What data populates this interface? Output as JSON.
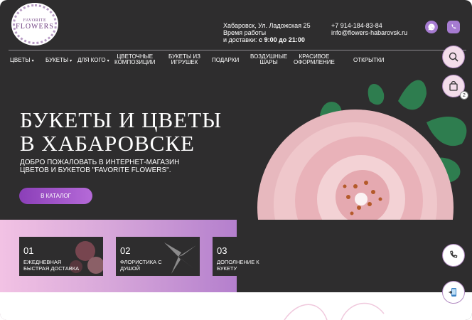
{
  "logo": {
    "line1": "FAVORITE",
    "line2": "FLOWERS"
  },
  "header": {
    "address": "Хабаровск, Ул. Ладожская 25",
    "hours_line1": "Время работы",
    "hours_line2": "и доставки:",
    "hours_value": "с 9:00 до 21:00",
    "phone": "+7 914-184-83-84",
    "email": "info@flowers-habarovsk.ru"
  },
  "nav": [
    {
      "l1": "Цветы",
      "l2": "",
      "caret": "▾"
    },
    {
      "l1": "Букеты",
      "l2": "",
      "caret": "▾"
    },
    {
      "l1": "Для кого",
      "l2": "",
      "caret": "▾"
    },
    {
      "l1": "Цветочные",
      "l2": "композиции",
      "caret": ""
    },
    {
      "l1": "Букеты из",
      "l2": "игрушек",
      "caret": ""
    },
    {
      "l1": "Подарки",
      "l2": "",
      "caret": ""
    },
    {
      "l1": "Воздушные",
      "l2": "шары",
      "caret": ""
    },
    {
      "l1": "Красивое",
      "l2": "оформление",
      "caret": ""
    },
    {
      "l1": "Открытки",
      "l2": "",
      "caret": ""
    }
  ],
  "cart_count": "2",
  "hero": {
    "title_line1": "БУКЕТЫ И ЦВЕТЫ",
    "title_line2": "В ХАБАРОВСКЕ",
    "subtitle_line1": "ДОБРО ПОЖАЛОВАТЬ В ИНТЕРНЕТ-МАГАЗИН",
    "subtitle_line2": "ЦВЕТОВ И БУКЕТОВ \"FAVORITE FLOWERS\".",
    "cta": "В каталог"
  },
  "features": [
    {
      "num": "01",
      "l1": "Ежедневная",
      "l2": "быстрая доставка"
    },
    {
      "num": "02",
      "l1": "Флористика с",
      "l2": "душой"
    },
    {
      "num": "03",
      "l1": "Дополнение к",
      "l2": "букету"
    }
  ],
  "colors": {
    "accent": "#a67bd1",
    "bg": "#2e2d2e",
    "cta": "#8b3fb8"
  }
}
